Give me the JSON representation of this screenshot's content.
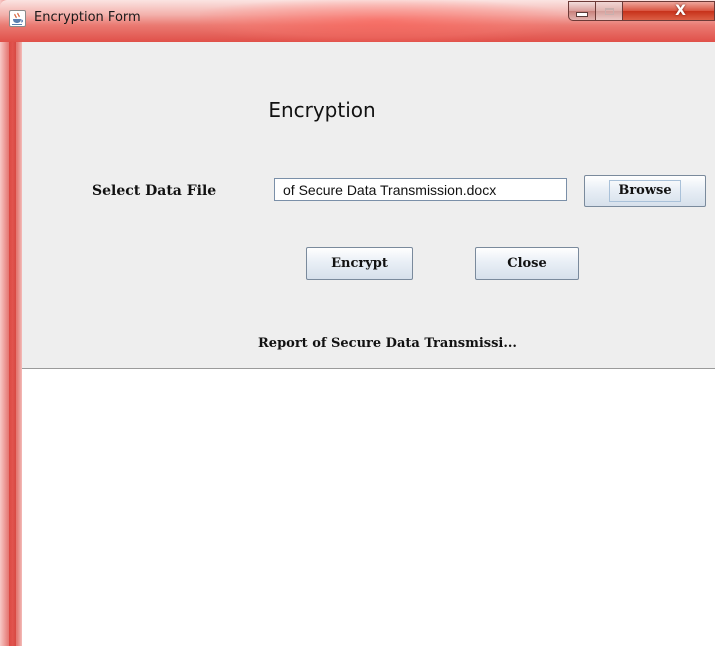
{
  "window": {
    "title": "Encryption Form",
    "icon": "java-cup-icon",
    "controls": [
      "minimize-icon",
      "maximize-icon",
      "close-icon"
    ],
    "close_glyph": "X"
  },
  "form": {
    "heading": "Encryption",
    "select_label": "Select Data File",
    "file_path_value": "of Secure Data Transmission.docx",
    "browse_label": "Browse",
    "encrypt_label": "Encrypt",
    "close_label": "Close",
    "report_text": "Report of Secure Data Transmissi..."
  },
  "colors": {
    "titlebar_accent": "#e05049",
    "panel_background": "#eeeeee"
  }
}
